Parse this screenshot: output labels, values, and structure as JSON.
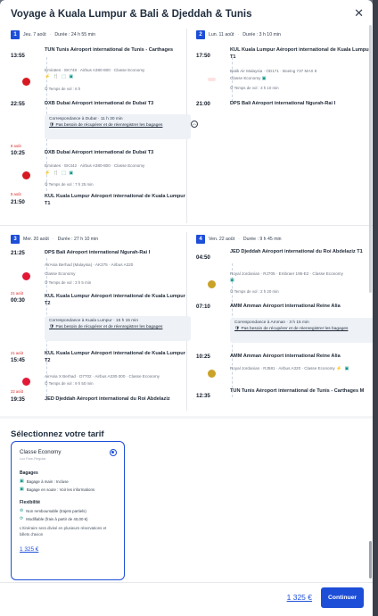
{
  "title": "Voyage à Kuala Lumpur & Bali & Djeddah & Tunis",
  "segments": [
    {
      "num": "1",
      "date": "Jeu. 7 août",
      "duration": "Durée : 24 h 55 min",
      "dep_time": "13:55",
      "dep_stop": "TUN Tunis Aéroport international de Tunis - Carthages",
      "meta1": "Emirates · EK748 · Airbus A380-800 · Classe Economy",
      "icons1": "⚡ 🍴 ⬚ ▣",
      "dur1": "⏱ Temps de vol : 6 h",
      "arr1_time": "22:55",
      "arr1_stop": "DXB Dubai Aéroport international de Dubaï T3",
      "conn_title": "Correspondance à Dubaï · 11 h 30 min",
      "conn_warn": "Pas besoin de récupérer et de réenregistrer les bagages",
      "date2": "8 août",
      "dep2_time": "10:25",
      "dep2_stop": "DXB Dubai Aéroport international de Dubaï T3",
      "meta2": "Emirates · EK342 · Airbus A380-800 · Classe Economy",
      "icons2": "⚡ 🍴 ⬚ ▣",
      "dur2": "⏱ Temps de vol : 7 h 25 min",
      "date3": "8 août",
      "arr2_time": "21:50",
      "arr2_stop": "KUL Kuala Lumpur Aéroport international de Kuala Lumpur T1"
    },
    {
      "num": "2",
      "date": "Lun. 11 août",
      "duration": "Durée : 3 h 10 min",
      "dep_time": "17:50",
      "dep_stop": "KUL Kuala Lumpur Aéroport international de Kuala Lumpur T1",
      "meta1": "Batik Air Malaysia · OD171 · Boeing 737 MAX 8",
      "meta1b": "Classe Economy",
      "icons1": "▣",
      "dur1": "⏱ Temps de vol : 3 h 10 min",
      "arr1_time": "21:00",
      "arr1_stop": "DPS Bali Aéroport international Ngurah-Rai I"
    },
    {
      "num": "3",
      "date": "Mer. 20 août",
      "duration": "Durée : 27 h 10 min",
      "dep_time": "21:25",
      "dep_stop": "DPS Bali Aéroport international Ngurah-Rai I",
      "meta1": "AirAsia Berhad (Malaysia) · AK375 · Airbus A320",
      "meta1b": "Classe Economy",
      "dur1": "⏱ Temps de vol : 3 h 5 min",
      "date2": "21 août",
      "arr1_time": "00:30",
      "arr1_stop": "KUL Kuala Lumpur Aéroport international de Kuala Lumpur T2",
      "conn_title": "Correspondance à Kuala Lumpur · 15 h 15 min",
      "conn_warn": "Pas besoin de récupérer et de réenregistrer les bagages",
      "date3": "21 août",
      "dep2_time": "15:45",
      "dep2_stop": "KUL Kuala Lumpur Aéroport international de Kuala Lumpur T2",
      "meta2": "AirAsia X Berhad · D7702 · Airbus A330-300 · Classe Economy",
      "dur2": "⏱ Temps de vol : 9 h 50 min",
      "date4": "22 août",
      "arr2_time": "19:35",
      "arr2_stop": "JED Djeddah Aéroport international du Roi Abdelaziz"
    },
    {
      "num": "4",
      "date": "Ven. 22 août",
      "duration": "Durée : 9 h 45 min",
      "dep_time": "04:50",
      "dep_stop": "JED Djeddah Aéroport international du Roi Abdelaziz T1",
      "meta1": "Royal Jordanian · RJ705 · Embraer 195-E2 · Classe Economy",
      "icons1": "▣",
      "dur1": "⏱ Temps de vol : 2 h 20 min",
      "arr1_time": "07:10",
      "arr1_stop": "AMM Amman Aéroport international Reine Alia",
      "conn_title": "Correspondance à Amman · 3 h 15 min",
      "conn_warn": "Pas besoin de récupérer et de réenregistrer les bagages",
      "dep2_time": "10:25",
      "dep2_stop": "AMM Amman Aéroport international Reine Alia",
      "meta2": "Royal Jordanian · RJ581 · Airbus A320 · Classe Economy",
      "icons2": "⚡ ▣",
      "arr2_time": "12:35",
      "arr2_stop": "TUN Tunis Aéroport international de Tunis - Carthages M"
    }
  ],
  "fare_section": {
    "title": "Sélectionnez votre tarif",
    "fare_name": "Classe Economy",
    "fare_sub": "Lux Fare-Regular",
    "baggage_title": "Bagages",
    "baggage1": "Bagage à main : Incluse",
    "baggage2": "Bagage en soute : Voir les informations",
    "flex_title": "Flexibilité",
    "flex1": "Non remboursable (trajets partiels)",
    "flex2": "Modifiable (frais à partir de 40,00 €)",
    "note": "L'itinéraire sera divisé en plusieurs réservations et billets d'avion",
    "price": "1 325 €"
  },
  "footer": {
    "price": "1 325 €",
    "continue": "Continuer"
  },
  "colors": {
    "accent": "#1d4ed8",
    "emirates": "#d71921",
    "airasia": "#e31837"
  }
}
